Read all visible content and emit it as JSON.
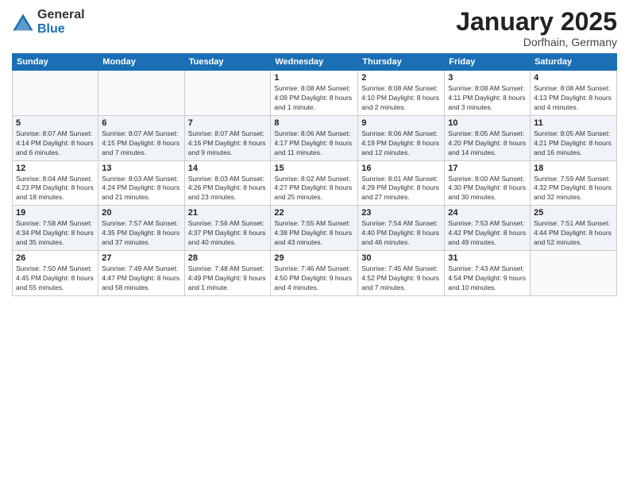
{
  "header": {
    "logo_general": "General",
    "logo_blue": "Blue",
    "month": "January 2025",
    "location": "Dorfhain, Germany"
  },
  "weekdays": [
    "Sunday",
    "Monday",
    "Tuesday",
    "Wednesday",
    "Thursday",
    "Friday",
    "Saturday"
  ],
  "weeks": [
    [
      {
        "day": "",
        "info": ""
      },
      {
        "day": "",
        "info": ""
      },
      {
        "day": "",
        "info": ""
      },
      {
        "day": "1",
        "info": "Sunrise: 8:08 AM\nSunset: 4:09 PM\nDaylight: 8 hours\nand 1 minute."
      },
      {
        "day": "2",
        "info": "Sunrise: 8:08 AM\nSunset: 4:10 PM\nDaylight: 8 hours\nand 2 minutes."
      },
      {
        "day": "3",
        "info": "Sunrise: 8:08 AM\nSunset: 4:11 PM\nDaylight: 8 hours\nand 3 minutes."
      },
      {
        "day": "4",
        "info": "Sunrise: 8:08 AM\nSunset: 4:13 PM\nDaylight: 8 hours\nand 4 minutes."
      }
    ],
    [
      {
        "day": "5",
        "info": "Sunrise: 8:07 AM\nSunset: 4:14 PM\nDaylight: 8 hours\nand 6 minutes."
      },
      {
        "day": "6",
        "info": "Sunrise: 8:07 AM\nSunset: 4:15 PM\nDaylight: 8 hours\nand 7 minutes."
      },
      {
        "day": "7",
        "info": "Sunrise: 8:07 AM\nSunset: 4:16 PM\nDaylight: 8 hours\nand 9 minutes."
      },
      {
        "day": "8",
        "info": "Sunrise: 8:06 AM\nSunset: 4:17 PM\nDaylight: 8 hours\nand 11 minutes."
      },
      {
        "day": "9",
        "info": "Sunrise: 8:06 AM\nSunset: 4:19 PM\nDaylight: 8 hours\nand 12 minutes."
      },
      {
        "day": "10",
        "info": "Sunrise: 8:05 AM\nSunset: 4:20 PM\nDaylight: 8 hours\nand 14 minutes."
      },
      {
        "day": "11",
        "info": "Sunrise: 8:05 AM\nSunset: 4:21 PM\nDaylight: 8 hours\nand 16 minutes."
      }
    ],
    [
      {
        "day": "12",
        "info": "Sunrise: 8:04 AM\nSunset: 4:23 PM\nDaylight: 8 hours\nand 18 minutes."
      },
      {
        "day": "13",
        "info": "Sunrise: 8:03 AM\nSunset: 4:24 PM\nDaylight: 8 hours\nand 21 minutes."
      },
      {
        "day": "14",
        "info": "Sunrise: 8:03 AM\nSunset: 4:26 PM\nDaylight: 8 hours\nand 23 minutes."
      },
      {
        "day": "15",
        "info": "Sunrise: 8:02 AM\nSunset: 4:27 PM\nDaylight: 8 hours\nand 25 minutes."
      },
      {
        "day": "16",
        "info": "Sunrise: 8:01 AM\nSunset: 4:29 PM\nDaylight: 8 hours\nand 27 minutes."
      },
      {
        "day": "17",
        "info": "Sunrise: 8:00 AM\nSunset: 4:30 PM\nDaylight: 8 hours\nand 30 minutes."
      },
      {
        "day": "18",
        "info": "Sunrise: 7:59 AM\nSunset: 4:32 PM\nDaylight: 8 hours\nand 32 minutes."
      }
    ],
    [
      {
        "day": "19",
        "info": "Sunrise: 7:58 AM\nSunset: 4:34 PM\nDaylight: 8 hours\nand 35 minutes."
      },
      {
        "day": "20",
        "info": "Sunrise: 7:57 AM\nSunset: 4:35 PM\nDaylight: 8 hours\nand 37 minutes."
      },
      {
        "day": "21",
        "info": "Sunrise: 7:56 AM\nSunset: 4:37 PM\nDaylight: 8 hours\nand 40 minutes."
      },
      {
        "day": "22",
        "info": "Sunrise: 7:55 AM\nSunset: 4:38 PM\nDaylight: 8 hours\nand 43 minutes."
      },
      {
        "day": "23",
        "info": "Sunrise: 7:54 AM\nSunset: 4:40 PM\nDaylight: 8 hours\nand 46 minutes."
      },
      {
        "day": "24",
        "info": "Sunrise: 7:53 AM\nSunset: 4:42 PM\nDaylight: 8 hours\nand 49 minutes."
      },
      {
        "day": "25",
        "info": "Sunrise: 7:51 AM\nSunset: 4:44 PM\nDaylight: 8 hours\nand 52 minutes."
      }
    ],
    [
      {
        "day": "26",
        "info": "Sunrise: 7:50 AM\nSunset: 4:45 PM\nDaylight: 8 hours\nand 55 minutes."
      },
      {
        "day": "27",
        "info": "Sunrise: 7:49 AM\nSunset: 4:47 PM\nDaylight: 8 hours\nand 58 minutes."
      },
      {
        "day": "28",
        "info": "Sunrise: 7:48 AM\nSunset: 4:49 PM\nDaylight: 9 hours\nand 1 minute."
      },
      {
        "day": "29",
        "info": "Sunrise: 7:46 AM\nSunset: 4:50 PM\nDaylight: 9 hours\nand 4 minutes."
      },
      {
        "day": "30",
        "info": "Sunrise: 7:45 AM\nSunset: 4:52 PM\nDaylight: 9 hours\nand 7 minutes."
      },
      {
        "day": "31",
        "info": "Sunrise: 7:43 AM\nSunset: 4:54 PM\nDaylight: 9 hours\nand 10 minutes."
      },
      {
        "day": "",
        "info": ""
      }
    ]
  ]
}
